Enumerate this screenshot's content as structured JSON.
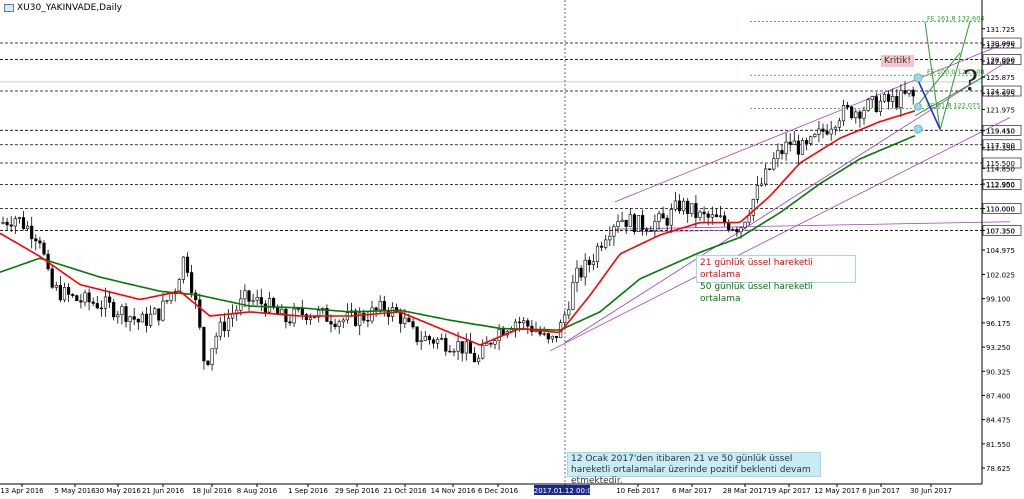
{
  "window_title": "XU30_YAKINVADE,Daily",
  "chart_data": {
    "type": "candlestick",
    "title": "XU30_YAKINVADE,Daily",
    "ylim": [
      76.7,
      135.2
    ],
    "y_tick_labels": [
      "131.725",
      "129.775",
      "127.825",
      "125.875",
      "123.925",
      "121.975",
      "119.410",
      "117.350",
      "114.850",
      "112.950",
      "110.000",
      "107.350",
      "104.975",
      "102.025",
      "99.100",
      "96.175",
      "93.250",
      "90.325",
      "87.400",
      "84.475",
      "81.550",
      "78.625"
    ],
    "x_tick_labels": [
      "13 Apr 2016",
      "5 May 2016",
      "30 May 2016",
      "21 Jun 2016",
      "18 Jul 2016",
      "8 Aug 2016",
      "1 Sep 2016",
      "29 Sep 2016",
      "21 Oct 2016",
      "14 Nov 2016",
      "6 Dec 2016",
      "2017.01.12 00:00",
      "10 Feb 2017",
      "6 Mar 2017",
      "28 Mar 2017",
      "19 Apr 2017",
      "12 May 2017",
      "6 Jun 2017",
      "30 Jun 2017"
    ],
    "horizontal_levels": [
      {
        "value": 130.0,
        "label": "130.000"
      },
      {
        "value": 128.0,
        "label": "128.000"
      },
      {
        "value": 124.2,
        "label": "124.200"
      },
      {
        "value": 119.45,
        "label": "119.450"
      },
      {
        "value": 117.7,
        "label": "117.700"
      },
      {
        "value": 115.5,
        "label": "115.500"
      },
      {
        "value": 112.9,
        "label": "112.900"
      },
      {
        "value": 110.0,
        "label": "110.000"
      },
      {
        "value": 107.35,
        "label": "107.350"
      }
    ],
    "fibonacci_expansion": [
      {
        "label": "FE 161.8 132.604",
        "value": 132.604
      },
      {
        "label": "FE 100.0 126.108",
        "value": 126.108
      },
      {
        "label": "FE 61.8 122.075",
        "value": 122.075
      }
    ],
    "price_anchors": [
      {
        "x": 0,
        "y": 108.2
      },
      {
        "x": 15,
        "y": 109.0
      },
      {
        "x": 40,
        "y": 106.5
      },
      {
        "x": 50,
        "y": 100.5
      },
      {
        "x": 75,
        "y": 99.0
      },
      {
        "x": 100,
        "y": 98.5
      },
      {
        "x": 125,
        "y": 97.5
      },
      {
        "x": 140,
        "y": 96.2
      },
      {
        "x": 160,
        "y": 97.5
      },
      {
        "x": 175,
        "y": 100.5
      },
      {
        "x": 185,
        "y": 104.5
      },
      {
        "x": 195,
        "y": 99.0
      },
      {
        "x": 205,
        "y": 91.0
      },
      {
        "x": 215,
        "y": 94.5
      },
      {
        "x": 230,
        "y": 97.0
      },
      {
        "x": 245,
        "y": 99.0
      },
      {
        "x": 265,
        "y": 98.5
      },
      {
        "x": 285,
        "y": 96.5
      },
      {
        "x": 305,
        "y": 97.5
      },
      {
        "x": 325,
        "y": 97.0
      },
      {
        "x": 345,
        "y": 96.5
      },
      {
        "x": 365,
        "y": 97.0
      },
      {
        "x": 385,
        "y": 98.0
      },
      {
        "x": 400,
        "y": 97.0
      },
      {
        "x": 415,
        "y": 94.5
      },
      {
        "x": 440,
        "y": 94.0
      },
      {
        "x": 460,
        "y": 93.5
      },
      {
        "x": 478,
        "y": 91.5
      },
      {
        "x": 495,
        "y": 95.0
      },
      {
        "x": 515,
        "y": 96.5
      },
      {
        "x": 535,
        "y": 95.5
      },
      {
        "x": 550,
        "y": 93.5
      },
      {
        "x": 562,
        "y": 96.0
      },
      {
        "x": 575,
        "y": 101.5
      },
      {
        "x": 590,
        "y": 103.5
      },
      {
        "x": 605,
        "y": 107.0
      },
      {
        "x": 618,
        "y": 109.0
      },
      {
        "x": 640,
        "y": 108.0
      },
      {
        "x": 665,
        "y": 108.5
      },
      {
        "x": 680,
        "y": 110.5
      },
      {
        "x": 700,
        "y": 109.0
      },
      {
        "x": 720,
        "y": 108.5
      },
      {
        "x": 740,
        "y": 107.8
      },
      {
        "x": 755,
        "y": 111.5
      },
      {
        "x": 775,
        "y": 116.0
      },
      {
        "x": 790,
        "y": 118.0
      },
      {
        "x": 805,
        "y": 117.0
      },
      {
        "x": 820,
        "y": 119.0
      },
      {
        "x": 840,
        "y": 121.5
      },
      {
        "x": 860,
        "y": 122.0
      },
      {
        "x": 880,
        "y": 122.8
      },
      {
        "x": 895,
        "y": 123.0
      },
      {
        "x": 910,
        "y": 123.8
      },
      {
        "x": 915,
        "y": 123.2
      }
    ],
    "ema21_anchors": [
      {
        "x": 0,
        "y": 107.0
      },
      {
        "x": 40,
        "y": 104.2
      },
      {
        "x": 80,
        "y": 100.8
      },
      {
        "x": 140,
        "y": 99.0
      },
      {
        "x": 180,
        "y": 100.0
      },
      {
        "x": 210,
        "y": 97.0
      },
      {
        "x": 250,
        "y": 97.5
      },
      {
        "x": 300,
        "y": 97.0
      },
      {
        "x": 350,
        "y": 97.0
      },
      {
        "x": 400,
        "y": 97.5
      },
      {
        "x": 440,
        "y": 95.5
      },
      {
        "x": 480,
        "y": 93.5
      },
      {
        "x": 520,
        "y": 95.5
      },
      {
        "x": 560,
        "y": 95.0
      },
      {
        "x": 590,
        "y": 99.5
      },
      {
        "x": 620,
        "y": 104.5
      },
      {
        "x": 660,
        "y": 106.8
      },
      {
        "x": 700,
        "y": 108.3
      },
      {
        "x": 740,
        "y": 108.3
      },
      {
        "x": 770,
        "y": 111.5
      },
      {
        "x": 800,
        "y": 115.5
      },
      {
        "x": 840,
        "y": 118.5
      },
      {
        "x": 880,
        "y": 120.5
      },
      {
        "x": 915,
        "y": 121.8
      }
    ],
    "ema50_anchors": [
      {
        "x": 0,
        "y": 102.3
      },
      {
        "x": 40,
        "y": 104.0
      },
      {
        "x": 100,
        "y": 101.7
      },
      {
        "x": 160,
        "y": 100.0
      },
      {
        "x": 200,
        "y": 99.5
      },
      {
        "x": 250,
        "y": 98.2
      },
      {
        "x": 300,
        "y": 98.0
      },
      {
        "x": 350,
        "y": 97.5
      },
      {
        "x": 400,
        "y": 97.7
      },
      {
        "x": 450,
        "y": 96.5
      },
      {
        "x": 500,
        "y": 95.5
      },
      {
        "x": 560,
        "y": 95.3
      },
      {
        "x": 600,
        "y": 97.5
      },
      {
        "x": 640,
        "y": 101.5
      },
      {
        "x": 700,
        "y": 104.7
      },
      {
        "x": 740,
        "y": 106.5
      },
      {
        "x": 780,
        "y": 109.5
      },
      {
        "x": 820,
        "y": 113.0
      },
      {
        "x": 860,
        "y": 116.0
      },
      {
        "x": 915,
        "y": 118.8
      }
    ],
    "legend": [
      {
        "label": "21 günlük üssel hareketli ortalama",
        "color": "#ff0000"
      },
      {
        "label": "50 günlük üssel hareketli ortalama",
        "color": "#007a00"
      }
    ],
    "annotations": {
      "kritik": "Kritik!",
      "question_mark": "?",
      "note": "12 Ocak 2017'den itibaren 21 ve 50 günlük üssel hareketli ortalamalar üzerinde pozitif beklenti devam etmektedir."
    },
    "colors": {
      "candle": "#000000",
      "ema21": "#ff0000",
      "ema50": "#007a00",
      "channel": "#a040c0",
      "fib": "#1fa31f",
      "projection": "#2a9b2a",
      "down_arrow": "#2233cc",
      "levels": "#000000",
      "vline": "#3a3aa0"
    }
  }
}
